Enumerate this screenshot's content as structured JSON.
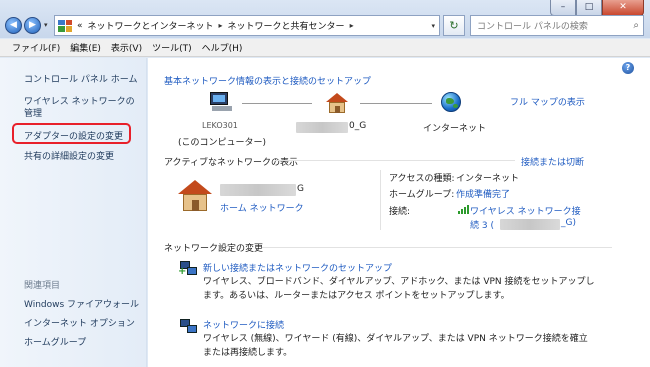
{
  "window": {
    "controls": {
      "min": "–",
      "max": "□",
      "close": "✕"
    }
  },
  "nav": {
    "back": "◀",
    "forward": "▶"
  },
  "address": {
    "prefix": "«",
    "crumbs": [
      "ネットワークとインターネット",
      "ネットワークと共有センター"
    ],
    "separator": "▸"
  },
  "search": {
    "placeholder": "コントロール パネルの検索"
  },
  "menu": [
    "ファイル(F)",
    "編集(E)",
    "表示(V)",
    "ツール(T)",
    "ヘルプ(H)"
  ],
  "sidebar": {
    "home": "コントロール パネル ホーム",
    "wireless": "ワイヤレス ネットワークの管理",
    "adapter": "アダプターの設定の変更",
    "sharing": "共有の詳細設定の変更",
    "see_also_title": "関連項目",
    "see_also": [
      "Windows ファイアウォール",
      "インターネット オプション",
      "ホームグループ"
    ]
  },
  "main": {
    "basic_title": "基本ネットワーク情報の表示と接続のセットアップ",
    "full_map": "フル マップの表示",
    "pc_label_top": "LEKO301",
    "pc_label": "(このコンピューター)",
    "router_label_suffix": "0_G",
    "internet_label": "インターネット",
    "active_title": "アクティブなネットワークの表示",
    "connect_disconnect": "接続または切断",
    "network_name_suffix": "G",
    "home_network": "ホーム ネットワーク",
    "access_type_label": "アクセスの種類:",
    "access_type_value": "インターネット",
    "homegroup_label": "ホームグループ:",
    "homegroup_value": "作成準備完了",
    "connections_label": "接続:",
    "connection_value_1": "ワイヤレス ネットワーク接",
    "connection_value_2_prefix": "続 3 (",
    "connection_value_2_suffix": "_G)",
    "change_title": "ネットワーク設定の変更",
    "task1_title": "新しい接続またはネットワークのセットアップ",
    "task1_desc1": "ワイヤレス、ブロードバンド、ダイヤルアップ、アドホック、または VPN 接続をセットアップし",
    "task1_desc2": "ます。あるいは、ルーターまたはアクセス ポイントをセットアップします。",
    "task2_title": "ネットワークに接続",
    "task2_desc1": "ワイヤレス (無線)、ワイヤード (有線)、ダイヤルアップ、または VPN ネットワーク接続を確立",
    "task2_desc2": "または再接続します。"
  },
  "help": "?",
  "search_icon": "⌕",
  "refresh_icon": "↻",
  "colors": {
    "link": "#1f5bc1",
    "highlight": "#e8202a"
  },
  "icons": [
    "back-arrow-icon",
    "forward-arrow-icon",
    "control-panel-icon",
    "refresh-icon",
    "search-icon",
    "help-icon",
    "computer-icon",
    "router-house-icon",
    "globe-icon",
    "home-network-icon",
    "wifi-signal-icon",
    "new-connection-icon",
    "connect-network-icon"
  ]
}
